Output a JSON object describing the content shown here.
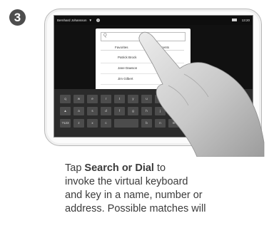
{
  "step": {
    "number": "3"
  },
  "status_bar": {
    "user_name": "Bernhard Johansson",
    "caret": "▼",
    "help": "?",
    "time": "13:20",
    "icons": {
      "camera": "camera-icon",
      "help": "help-icon"
    }
  },
  "search": {
    "icon": "search-icon",
    "value": "Q"
  },
  "tabs": [
    {
      "label": "Favorites"
    },
    {
      "label": "Recents"
    }
  ],
  "contacts": [
    {
      "name": "Patrick Brock"
    },
    {
      "name": "Jane Dawson"
    },
    {
      "name": "Jim Gilbert"
    }
  ],
  "keyboard": {
    "row1": [
      "q",
      "w",
      "e",
      "r",
      "t",
      "y",
      "u",
      "i",
      "o",
      "p"
    ],
    "row2": [
      "▲",
      "a",
      "s",
      "d",
      "f",
      "g",
      "h",
      "j",
      "k",
      "l"
    ],
    "row3": [
      "?123",
      "z",
      "x",
      "c",
      "",
      "b",
      "n",
      "m"
    ]
  },
  "caption": {
    "line1_prefix": "Tap ",
    "line1_bold": "Search or Dial",
    "line1_suffix": " to",
    "line2": "invoke the virtual keyboard",
    "line3": "and key in a name, number or",
    "line4": "address. Possible matches will"
  },
  "colors": {
    "badge": "#4d4d4d",
    "text": "#3b3b3b",
    "screen_bg": "#111111",
    "keyboard_bg": "#2b2b2b"
  }
}
